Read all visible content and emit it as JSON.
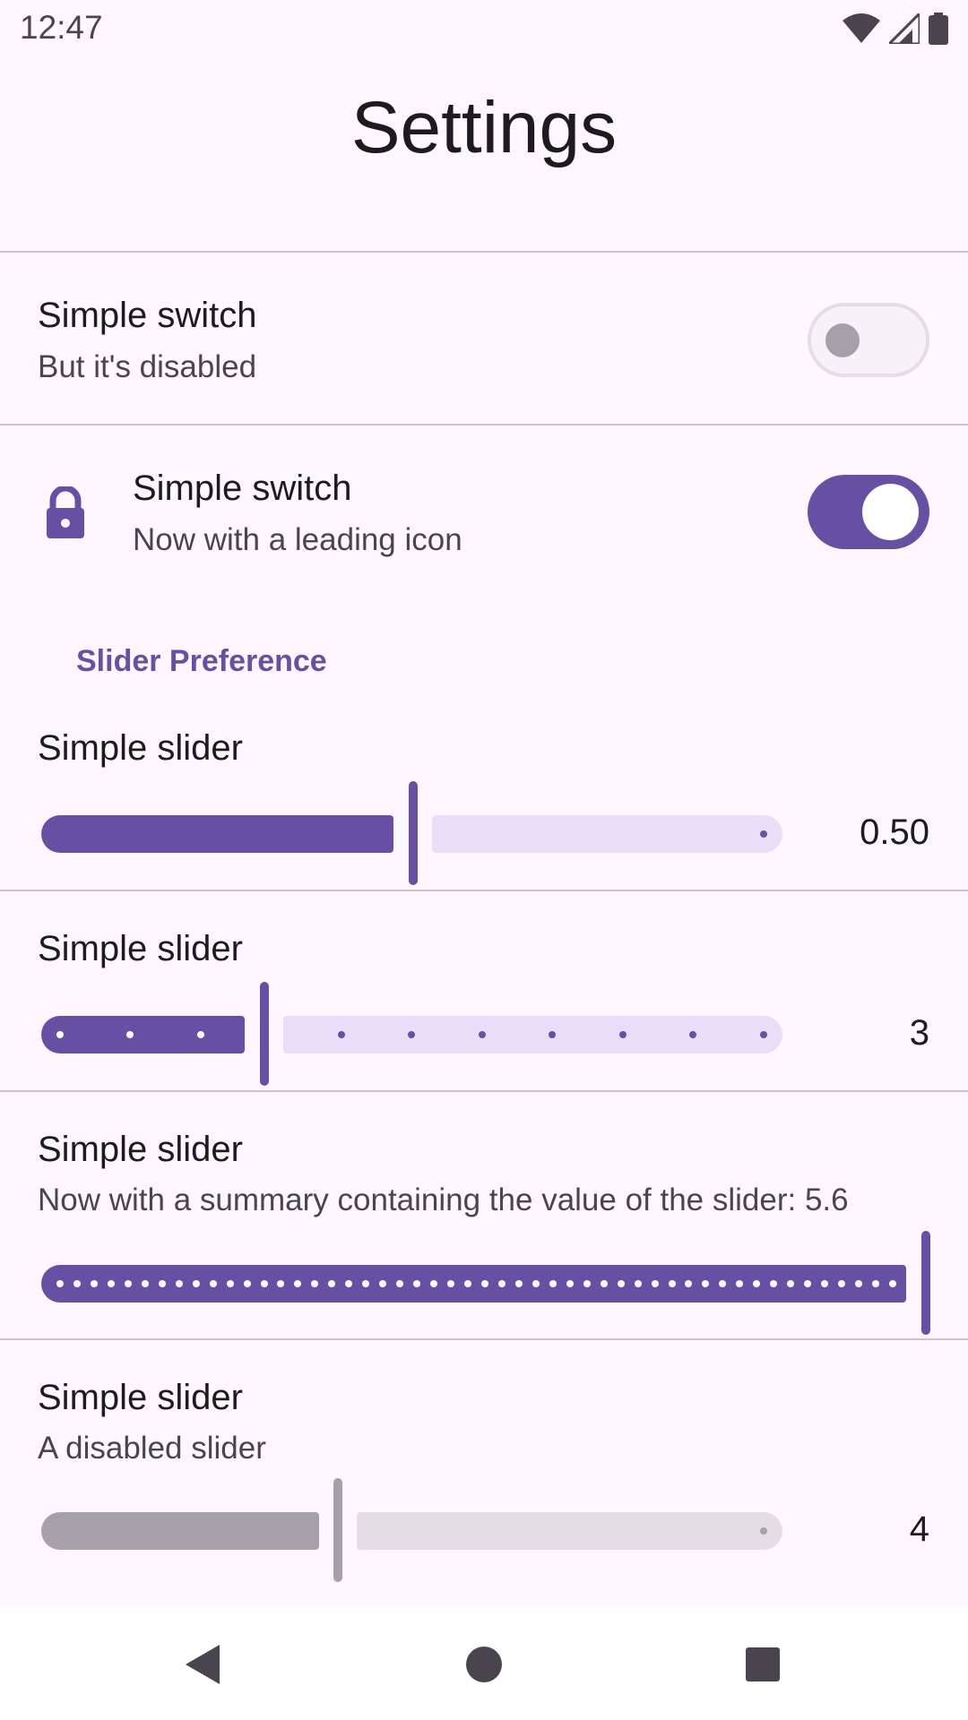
{
  "status_bar": {
    "time": "12:47",
    "icons": [
      "wifi-icon",
      "cellular-signal-icon",
      "battery-icon"
    ]
  },
  "page": {
    "title": "Settings"
  },
  "preferences": [
    {
      "title": "Simple switch",
      "summary": "But it's disabled",
      "type": "switch",
      "checked": false,
      "enabled": false
    },
    {
      "title": "Simple switch",
      "summary": "Now with a leading icon",
      "type": "switch",
      "checked": true,
      "enabled": true,
      "icon": "lock-icon"
    }
  ],
  "slider_section": {
    "header": "Slider Preference",
    "sliders": [
      {
        "title": "Simple slider",
        "summary": "",
        "value": 0.5,
        "value_label": "0.50",
        "min": 0,
        "max": 1,
        "steps": 0,
        "enabled": true
      },
      {
        "title": "Simple slider",
        "summary": "",
        "value": 3,
        "value_label": "3",
        "min": 0,
        "max": 10,
        "steps": 10,
        "enabled": true
      },
      {
        "title": "Simple slider",
        "summary": "Now with a summary containing the value of the slider: 5.6",
        "value": 5.6,
        "value_label": "",
        "min": 0,
        "max": 5.6,
        "steps": 50,
        "enabled": true
      },
      {
        "title": "Simple slider",
        "summary": "A disabled slider",
        "value": 4,
        "value_label": "4",
        "min": 0,
        "max": 10,
        "steps": 0,
        "enabled": false
      }
    ]
  },
  "colors": {
    "primary": "#6750A4",
    "primary_container": "#E8DEF8",
    "background": "#FEF7FF",
    "disabled_active": "#A5A1A8",
    "disabled_track": "#E3DDE4"
  },
  "nav_bar": {
    "buttons": [
      "back-icon",
      "home-icon",
      "recents-icon"
    ]
  }
}
